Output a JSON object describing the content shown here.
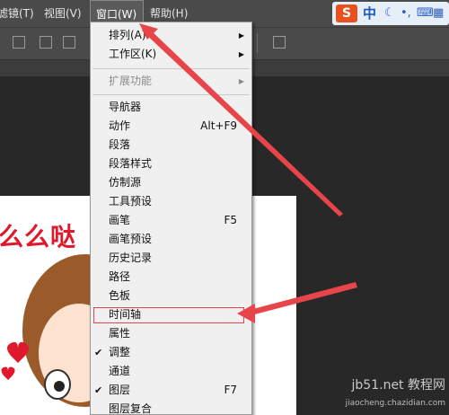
{
  "menubar": {
    "items": [
      {
        "label": "滤镜(T)"
      },
      {
        "label": "视图(V)"
      },
      {
        "label": "窗口(W)"
      },
      {
        "label": "帮助(H)"
      }
    ]
  },
  "ime": {
    "logo": "S",
    "lang": "中"
  },
  "window_menu": {
    "items": [
      {
        "label": "排列(A)",
        "shortcut": ""
      },
      {
        "label": "工作区(K)",
        "shortcut": ""
      },
      {
        "label": "扩展功能",
        "shortcut": ""
      },
      {
        "label": "导航器",
        "shortcut": ""
      },
      {
        "label": "动作",
        "shortcut": "Alt+F9"
      },
      {
        "label": "段落",
        "shortcut": ""
      },
      {
        "label": "段落样式",
        "shortcut": ""
      },
      {
        "label": "仿制源",
        "shortcut": ""
      },
      {
        "label": "工具预设",
        "shortcut": ""
      },
      {
        "label": "画笔",
        "shortcut": "F5"
      },
      {
        "label": "画笔预设",
        "shortcut": ""
      },
      {
        "label": "历史记录",
        "shortcut": ""
      },
      {
        "label": "路径",
        "shortcut": ""
      },
      {
        "label": "色板",
        "shortcut": ""
      },
      {
        "label": "时间轴",
        "shortcut": ""
      },
      {
        "label": "属性",
        "shortcut": ""
      },
      {
        "label": "调整",
        "shortcut": ""
      },
      {
        "label": "通道",
        "shortcut": ""
      },
      {
        "label": "图层",
        "shortcut": "F7"
      },
      {
        "label": "图层复合",
        "shortcut": ""
      }
    ]
  },
  "document": {
    "text": "么么哒"
  },
  "watermark": {
    "line1": "jb51.net 教程网",
    "line2": "jiaocheng.chazidian.com"
  },
  "colors": {
    "accent_red": "#e8454a",
    "menu_bg": "#f0f0f0"
  }
}
